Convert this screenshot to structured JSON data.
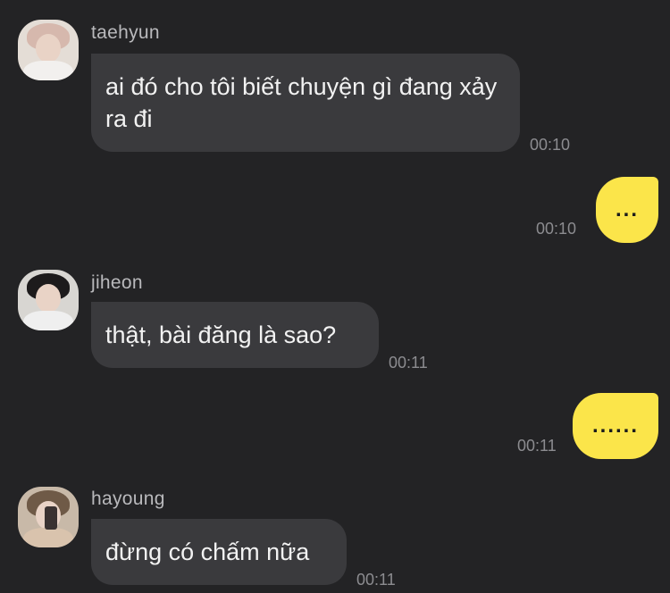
{
  "colors": {
    "background": "#232325",
    "incoming_bubble": "#3a3a3d",
    "outgoing_bubble": "#fbe54a",
    "sender_name": "#b9b9bc",
    "timestamp": "#8c8c90"
  },
  "messages": [
    {
      "sender": "taehyun",
      "text": "ai đó cho tôi biết chuyện gì đang xảy ra đi",
      "time": "00:10",
      "direction": "incoming"
    },
    {
      "text": "...",
      "time": "00:10",
      "direction": "outgoing"
    },
    {
      "sender": "jiheon",
      "text": "thật, bài đăng là sao?",
      "time": "00:11",
      "direction": "incoming"
    },
    {
      "text": "......",
      "time": "00:11",
      "direction": "outgoing"
    },
    {
      "sender": "hayoung",
      "text": "đừng có chấm nữa",
      "time": "00:11",
      "direction": "incoming"
    }
  ]
}
